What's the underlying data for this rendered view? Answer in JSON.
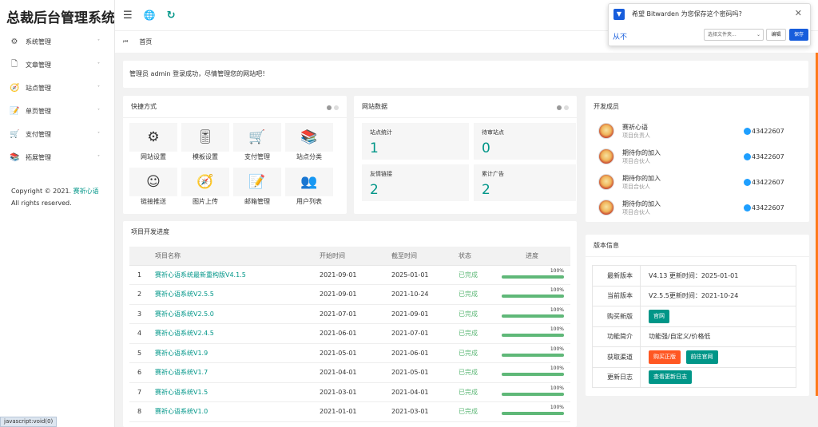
{
  "app": {
    "title": "总裁后台管理系统"
  },
  "sidebar": {
    "items": [
      {
        "icon": "⚙",
        "label": "系统管理"
      },
      {
        "icon": "🗋",
        "label": "文章管理"
      },
      {
        "icon": "🧭",
        "label": "站点管理"
      },
      {
        "icon": "📝",
        "label": "单页管理"
      },
      {
        "icon": "🛒",
        "label": "支付管理"
      },
      {
        "icon": "📚",
        "label": "拓展管理"
      }
    ],
    "arrow": "˅",
    "copyright_prefix": "Copyright © 2021.",
    "copyright_link": "赛祈心语",
    "copyright_suffix": "All rights reserved."
  },
  "topbar": {
    "menu_icon": "☰",
    "globe_icon": "🌐",
    "refresh_icon": "↻"
  },
  "tabbar": {
    "left_icon": "⏮",
    "home_label": "首页"
  },
  "notice": "管理员 admin 登录成功，尽情管理您的网站吧！",
  "shortcuts": {
    "title": "快捷方式",
    "items": [
      {
        "icon": "⚙",
        "label": "网站设置"
      },
      {
        "icon": "🎚",
        "label": "模板设置"
      },
      {
        "icon": "🛒",
        "label": "支付管理"
      },
      {
        "icon": "📚",
        "label": "站点分类"
      },
      {
        "icon": "☺",
        "label": "链接推送"
      },
      {
        "icon": "🧭",
        "label": "图片上传"
      },
      {
        "icon": "📝",
        "label": "邮箱管理"
      },
      {
        "icon": "👥",
        "label": "用户列表"
      }
    ]
  },
  "site_data": {
    "title": "网站数据",
    "stats": [
      {
        "label": "站点统计",
        "value": "1"
      },
      {
        "label": "待审站点",
        "value": "0"
      },
      {
        "label": "友情链接",
        "value": "2"
      },
      {
        "label": "累计广告",
        "value": "2"
      }
    ]
  },
  "team": {
    "title": "开发成员",
    "members": [
      {
        "name": "赛祈心语",
        "role": "项目负责人",
        "qq": "43422607"
      },
      {
        "name": "期待你的加入",
        "role": "项目合伙人",
        "qq": "43422607"
      },
      {
        "name": "期待你的加入",
        "role": "项目合伙人",
        "qq": "43422607"
      },
      {
        "name": "期待你的加入",
        "role": "项目合伙人",
        "qq": "43422607"
      }
    ]
  },
  "progress": {
    "title": "项目开发进度",
    "headers": [
      "",
      "项目名称",
      "开始时间",
      "截至时间",
      "状态",
      "进度"
    ],
    "rows": [
      {
        "no": "1",
        "name": "赛祈心语系统最新重构版V4.1.5",
        "start": "2021-09-01",
        "end": "2025-01-01",
        "status": "已完成",
        "pct": "100%",
        "progress": 1.0
      },
      {
        "no": "2",
        "name": "赛祈心语系统V2.5.5",
        "start": "2021-09-01",
        "end": "2021-10-24",
        "status": "已完成",
        "pct": "100%",
        "progress": 1.0
      },
      {
        "no": "3",
        "name": "赛祈心语系统V2.5.0",
        "start": "2021-07-01",
        "end": "2021-09-01",
        "status": "已完成",
        "pct": "100%",
        "progress": 1.0
      },
      {
        "no": "4",
        "name": "赛祈心语系统V2.4.5",
        "start": "2021-06-01",
        "end": "2021-07-01",
        "status": "已完成",
        "pct": "100%",
        "progress": 1.0
      },
      {
        "no": "5",
        "name": "赛祈心语系统V1.9",
        "start": "2021-05-01",
        "end": "2021-06-01",
        "status": "已完成",
        "pct": "100%",
        "progress": 1.0
      },
      {
        "no": "6",
        "name": "赛祈心语系统V1.7",
        "start": "2021-04-01",
        "end": "2021-05-01",
        "status": "已完成",
        "pct": "100%",
        "progress": 1.0
      },
      {
        "no": "7",
        "name": "赛祈心语系统V1.5",
        "start": "2021-03-01",
        "end": "2021-04-01",
        "status": "已完成",
        "pct": "100%",
        "progress": 1.0
      },
      {
        "no": "8",
        "name": "赛祈心语系统V1.0",
        "start": "2021-01-01",
        "end": "2021-03-01",
        "status": "已完成",
        "pct": "100%",
        "progress": 1.0
      }
    ]
  },
  "version": {
    "title": "版本信息",
    "latest_label": "最新版本",
    "latest_value": "V4.13 更新时间：2025-01-01",
    "current_label": "当前版本",
    "current_value": "V2.5.5更新时间：2021-10-24",
    "buy_label": "购买新版",
    "buy_btn": "官网",
    "intro_label": "功能简介",
    "intro_value": "功能强/自定义/价格低",
    "channel_label": "获取渠道",
    "channel_btn1": "购买正版",
    "channel_btn2": "前往官网",
    "log_label": "更新日志",
    "log_btn": "查看更新日志"
  },
  "bitwarden": {
    "logo": "▼",
    "message": "希望 Bitwarden 为您保存这个密码吗?",
    "close": "✕",
    "never": "从不",
    "folder_placeholder": "选择文件夹...",
    "edit": "编辑",
    "save": "保存"
  },
  "statusbar": "javascript:void(0)",
  "colors": {
    "accent": "#009688",
    "done": "#5FB878",
    "orange": "#FF5722",
    "bitwarden": "#175ddc"
  }
}
